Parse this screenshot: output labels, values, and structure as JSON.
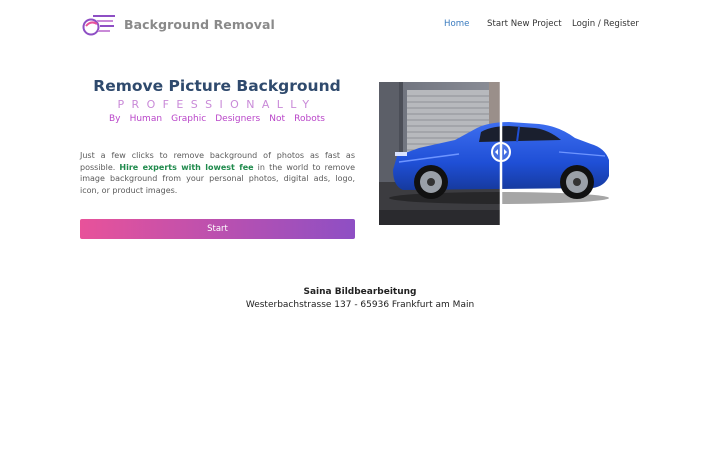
{
  "header": {
    "brand": "Background Removal",
    "nav": [
      {
        "label": "Home",
        "active": true
      },
      {
        "label": "Start New Project",
        "active": false
      },
      {
        "label": "Login / Register",
        "active": false
      }
    ]
  },
  "hero": {
    "title": "Remove Picture Background",
    "subtitle": "PROFESSIONALLY",
    "tagline_words": [
      "By",
      "Human",
      "Graphic",
      "Designers",
      "Not",
      "Robots"
    ],
    "description_before": "Just a few clicks to remove background of photos as fast as possible. ",
    "description_highlight": "Hire experts with lowest fee",
    "description_after": " in the world to remove image background from your personal photos, digital ads, logo, icon, or product images.",
    "start_label": "Start"
  },
  "comparison": {
    "slider_icon": "left-right-arrows-icon"
  },
  "footer": {
    "company": "Saina Bildbearbeitung",
    "address": "Westerbachstrasse 137 - 65936 Frankfurt am Main"
  },
  "colors": {
    "brand_text": "#8a8a8a",
    "nav_active": "#3a7bbf",
    "title": "#2f4a6d",
    "subtitle": "#c98ad8",
    "tagline": "#b946c9",
    "highlight": "#1f8a4c",
    "button_start": "#e8529a",
    "button_end": "#8e4fc4",
    "car_blue": "#1f4fd6"
  }
}
